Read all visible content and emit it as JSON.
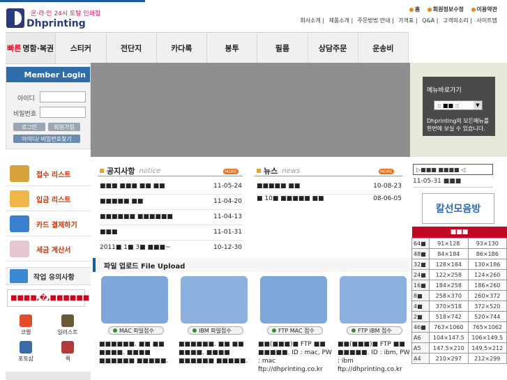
{
  "header": {
    "logo_tagline": "온·라·인 24시 토탈 인쇄점",
    "logo_name": "Dhprinting",
    "top_links": [
      "홈",
      "회원정보수정",
      "이용약관"
    ],
    "sub_links": [
      "회사소개",
      "제품소개",
      "주문방법 안내",
      "가격표",
      "Q&A",
      "고객의소리",
      "사이트맵"
    ]
  },
  "nav": {
    "first_prefix": "빠른",
    "items": [
      "명함·복권",
      "스티커",
      "전단지",
      "카다록",
      "봉투",
      "필름",
      "상담주문",
      "운송비"
    ]
  },
  "login": {
    "title": "Member Login",
    "id_label": "아이디",
    "pw_label": "비밀번호",
    "login_btn": "로그인",
    "join_btn": "회원가입",
    "find_btn": "아이디/ 비밀번호찾기"
  },
  "menu_nav": {
    "title": "메뉴바로가기",
    "select_value": ":: ■■ ::",
    "desc": "Dhprinting의 모든메뉴를 한번에 보실 수 있습니다."
  },
  "sidebar": {
    "items": [
      "접수 리스트",
      "입금 리스트",
      "카드 결제하기",
      "세금 계산서"
    ],
    "work_note": "작업 유의사항",
    "notice": "■■■■,�,■■■■■■",
    "tools": [
      "코렐",
      "일러스트",
      "포토샵",
      "쿽"
    ]
  },
  "notice_panel": {
    "title": "공지사항",
    "en": "notice",
    "more": "MORE",
    "rows": [
      {
        "text": "■■■ ■■■ ■■ ■■",
        "date": "11-05-24"
      },
      {
        "text": "■■■■■ ■■",
        "date": "11-04-20"
      },
      {
        "text": "■■■■■■ ■■■■■■",
        "date": "11-04-13"
      },
      {
        "text": "■■■",
        "date": "11-01-31"
      },
      {
        "text": "2011■ 1■ 3■ ■■■~",
        "date": "10-12-30"
      }
    ]
  },
  "news_panel": {
    "title": "뉴스",
    "en": "news",
    "more": "MORE",
    "rows": [
      {
        "text": "■■■■■ ■■",
        "date": "10-08-23"
      },
      {
        "text": "■ 10■ ■■■■■ ■■",
        "date": "08-06-05"
      }
    ]
  },
  "upload": {
    "title": "파일 업로드 File Upload",
    "cards": [
      {
        "btn": "MAC 파일접수",
        "desc": "■■■■■■. ■■ ■■ ■■■■. ■■■■ ■■■■■■ ■■■■■."
      },
      {
        "btn": "IBM 파일접수",
        "desc": "■■■■■■. ■■ ■■ ■■■■. ■■■■ ■■■■■■ ■■■■■."
      },
      {
        "btn": "FTP MAC 접수",
        "desc": "■■(■■■)■ FTP ■■ ■■■■■. ID : mac, PW : mac ftp://dhprinting.co.kr"
      },
      {
        "btn": "FTP IBM 접수",
        "desc": "■■(■■■)■ FTP ■■ ■■■■■. ID : ibm, PW : ibm ftp://dhprinting.co.kr"
      }
    ]
  },
  "right": {
    "head": "▷■■■ ■■■■ ◁",
    "date": "11-05-31",
    "date_text": "■■■",
    "kalsun": "칼선모음방",
    "size_header": "■■■",
    "sizes": [
      [
        "64■",
        "91×128",
        "93×130"
      ],
      [
        "48■",
        "84×184",
        "86×186"
      ],
      [
        "32■",
        "128×184",
        "130×186"
      ],
      [
        "24■",
        "122×258",
        "124×260"
      ],
      [
        "16■",
        "184×258",
        "186×260"
      ],
      [
        "8■",
        "258×370",
        "260×372"
      ],
      [
        "4■",
        "370×518",
        "372×520"
      ],
      [
        "2■",
        "518×742",
        "520×744"
      ],
      [
        "46■",
        "763×1060",
        "765×1062"
      ],
      [
        "A6",
        "104×147.5",
        "106×149.5"
      ],
      [
        "A5",
        "147.5×210",
        "149.5×212"
      ],
      [
        "A4",
        "210×297",
        "212×299"
      ]
    ]
  },
  "colors": {
    "brand_blue": "#1a5c9c",
    "accent_red": "#c20827",
    "accent_orange": "#e86a1b"
  }
}
